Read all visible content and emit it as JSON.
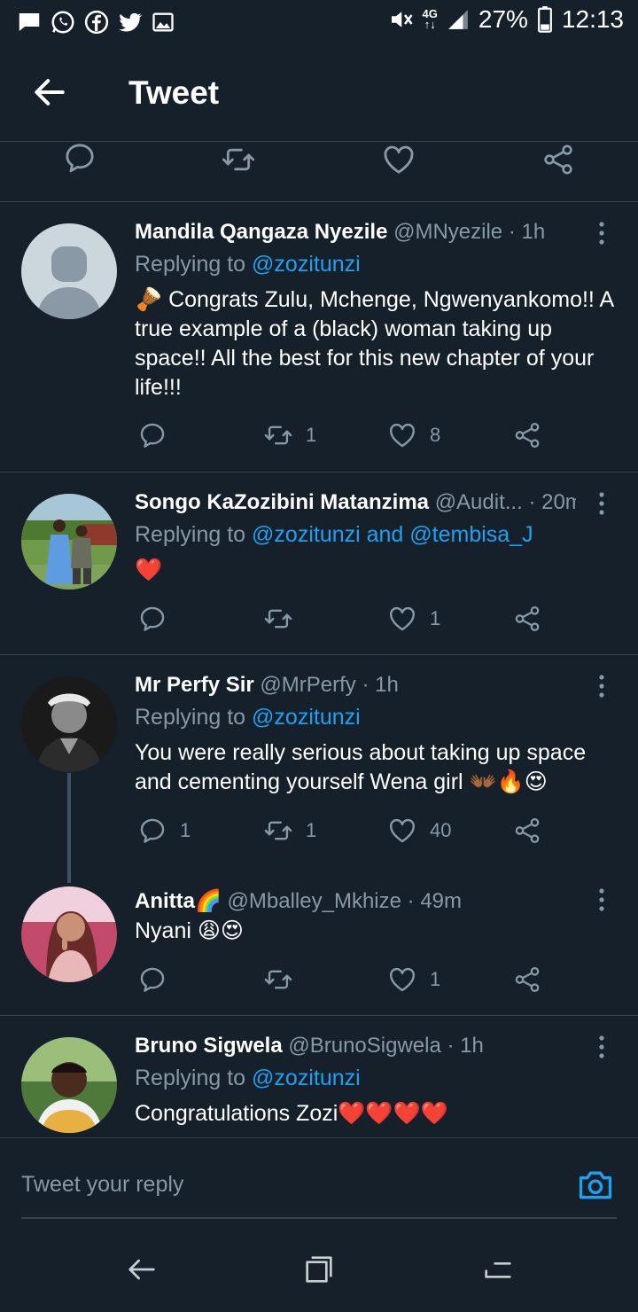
{
  "status": {
    "battery": "27%",
    "time": "12:13",
    "network_top": "4G",
    "network_bottom": "↑↓"
  },
  "appbar": {
    "title": "Tweet"
  },
  "tweets": [
    {
      "name": "Mandila Qangaza Nyezile",
      "handle": "@MNyezile",
      "time": "· 1h",
      "reply_prefix": "Replying to ",
      "reply_to": "@zozitunzi",
      "body": "🪘 Congrats Zulu, Mchenge, Ngwenyankomo!! A true example of a (black) woman taking up space!! All the best  for this new chapter of your life!!!",
      "replies": "",
      "retweets": "1",
      "likes": "8"
    },
    {
      "name": "Songo KaZozibini Matanzima",
      "handle": "@Audit...",
      "time": "· 20m",
      "reply_prefix": "Replying to ",
      "reply_to": "@zozitunzi and @tembisa_J",
      "body": "❤️",
      "replies": "",
      "retweets": "",
      "likes": "1"
    },
    {
      "name": "Mr Perfy Sir",
      "handle": "@MrPerfy",
      "time": "· 1h",
      "reply_prefix": "Replying to ",
      "reply_to": "@zozitunzi",
      "body": "You were really serious about taking up space and cementing yourself Wena girl 👐🏾🔥😍",
      "replies": "1",
      "retweets": "1",
      "likes": "40"
    },
    {
      "name": "Anitta🌈",
      "handle": "@Mballey_Mkhize",
      "time": "· 49m",
      "body": "Nyani 😩😍",
      "replies": "",
      "retweets": "",
      "likes": "1"
    },
    {
      "name": "Bruno Sigwela",
      "handle": "@BrunoSigwela",
      "time": "· 1h",
      "reply_prefix": "Replying to ",
      "reply_to": "@zozitunzi",
      "body": "Congratulations Zozi❤️❤️❤️❤️"
    }
  ],
  "reply_bar": {
    "placeholder": "Tweet your reply"
  },
  "icons": {
    "status_left": [
      "message-icon",
      "whatsapp-icon",
      "facebook-icon",
      "twitter-icon",
      "image-icon"
    ],
    "status_right": [
      "mute-icon",
      "signal-icon",
      "battery-icon"
    ],
    "actions": [
      "reply-icon",
      "retweet-icon",
      "like-icon",
      "share-icon",
      "more-icon"
    ],
    "nav": [
      "nav-back-icon",
      "nav-recents-icon",
      "nav-menu-icon"
    ]
  },
  "colors": {
    "background": "#15202b",
    "divider": "#38444d",
    "link": "#1da1f2",
    "secondary_text": "#8899a6",
    "heart": "#e0245e"
  }
}
